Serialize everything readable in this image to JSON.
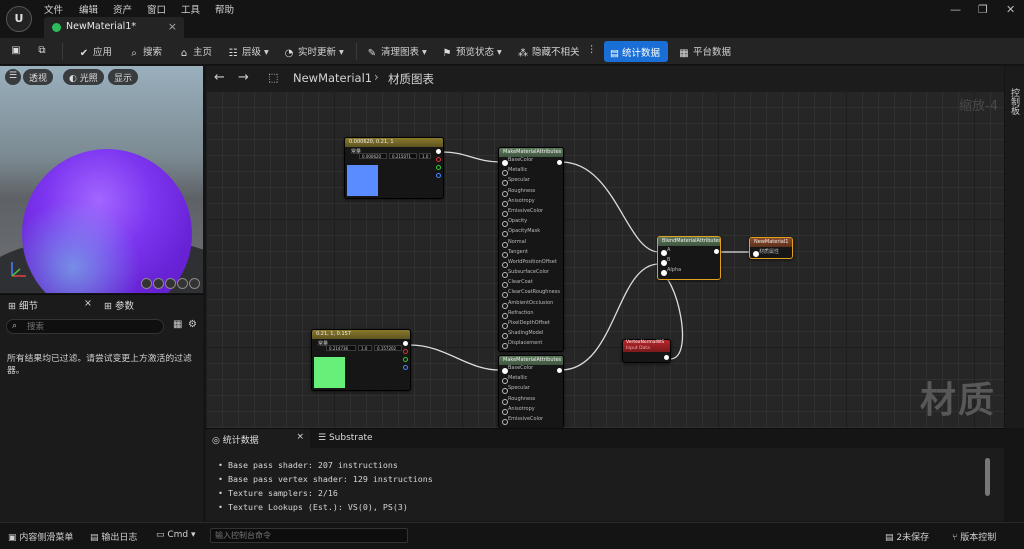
{
  "menu": [
    "文件",
    "编辑",
    "资产",
    "窗口",
    "工具",
    "帮助"
  ],
  "doc_tab": {
    "label": "NewMaterial1*"
  },
  "toolbar": {
    "apply": "应用",
    "search": "搜索",
    "home": "主页",
    "hierarchy": "层级",
    "live_update": "实时更新",
    "clean_graph": "清理图表",
    "preview_state": "预览状态",
    "hide_unrelated": "隐藏不相关",
    "stats": "统计数据",
    "platform_stats": "平台数据"
  },
  "viewport": {
    "perspective": "透视",
    "lit": "光照",
    "show": "显示"
  },
  "details": {
    "tab_details": "细节",
    "tab_params": "参数",
    "search_placeholder": "搜索",
    "filter_message": "所有结果均已过滤。请尝试变更上方激活的过滤器。"
  },
  "graph": {
    "breadcrumb_asset": "NewMaterial1",
    "breadcrumb_sep": "›",
    "breadcrumb_graph": "材质图表",
    "zoom": "缩放-4",
    "watermark": "材质",
    "side_tab": "控制板"
  },
  "nodes": {
    "const_blue": {
      "title": "0.000620, 0.21, 1",
      "label": "常量",
      "r": "0.000620",
      "g": "0.215071",
      "b": "1.0",
      "color": "#5a8cff"
    },
    "const_green": {
      "title": "0.21, 1, 0.157",
      "label": "常量",
      "r": "0.214736",
      "g": "1.0",
      "b": "0.157202",
      "color": "#66f07a"
    },
    "make_attr_top": {
      "title": "MakeMaterialAttributes"
    },
    "make_attr_bottom": {
      "title": "MakeMaterialAttributes"
    },
    "blend": {
      "title": "BlendMaterialAttributes",
      "pins": [
        "A",
        "B",
        "Alpha"
      ]
    },
    "result": {
      "title": "NewMaterial1",
      "pin": "材质属性"
    },
    "vertex_normal": {
      "title": "VertexNormalWS",
      "sub": "Input Data"
    },
    "attr_pins_top": [
      "BaseColor",
      "Metallic",
      "Specular",
      "Roughness",
      "Anisotropy",
      "EmissiveColor",
      "Opacity",
      "OpacityMask",
      "Normal",
      "Tangent",
      "WorldPositionOffset",
      "SubsurfaceColor",
      "ClearCoat",
      "ClearCoatRoughness",
      "AmbientOcclusion",
      "Refraction",
      "PixelDepthOffset",
      "ShadingModel",
      "Displacement"
    ],
    "attr_pins_bottom": [
      "BaseColor",
      "Metallic",
      "Specular",
      "Roughness",
      "Anisotropy",
      "EmissiveColor"
    ]
  },
  "stats_panel": {
    "tab_stats": "统计数据",
    "tab_substrate": "Substrate",
    "lines": [
      "• Base pass shader: 207 instructions",
      "• Base pass vertex shader: 129 instructions",
      "• Texture samplers: 2/16",
      "• Texture Lookups (Est.): VS(0), PS(3)"
    ]
  },
  "statusbar": {
    "content_drawer": "内容侧滑菜单",
    "output_log": "输出日志",
    "cmd": "Cmd",
    "console_placeholder": "输入控制台命令",
    "unsaved": "2未保存",
    "source_control": "版本控制"
  }
}
